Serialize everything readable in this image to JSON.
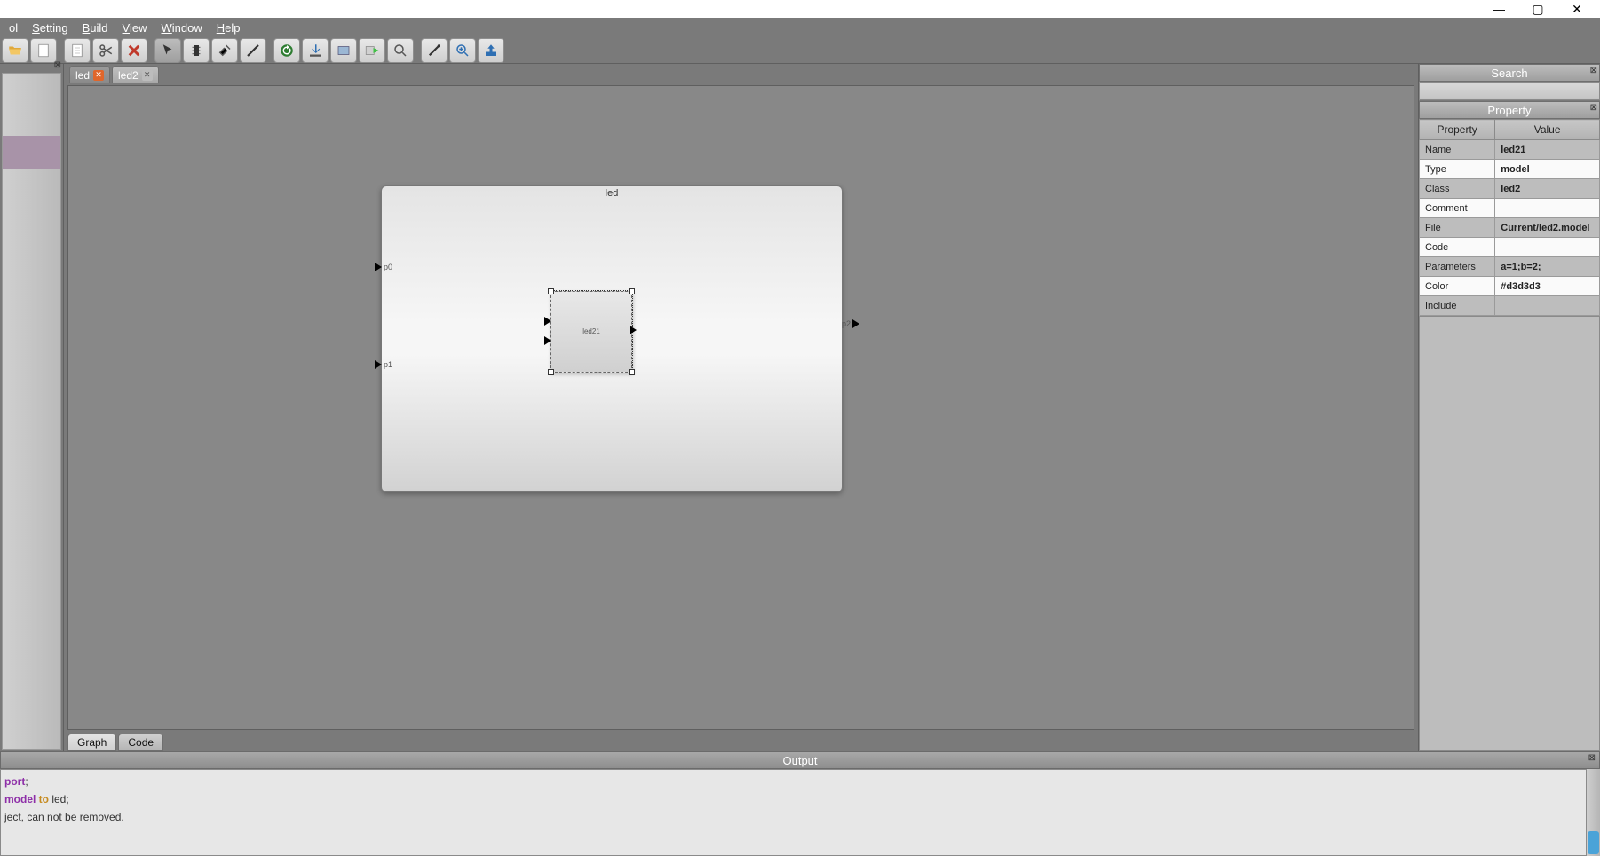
{
  "titlebar": {
    "min": "—",
    "max": "▢",
    "close": "✕"
  },
  "menu": {
    "items": [
      "ol",
      "Setting",
      "Build",
      "View",
      "Window",
      "Help"
    ]
  },
  "toolbar": {
    "icons": [
      "open",
      "new",
      "doc",
      "cut",
      "delete",
      "pointer",
      "device",
      "clean",
      "erase",
      "pencil",
      "refresh",
      "download",
      "rect",
      "run",
      "find",
      "wand",
      "zoomplus",
      "export"
    ]
  },
  "tabs": [
    {
      "label": "led",
      "closeStyle": "orange",
      "active": true
    },
    {
      "label": "led2",
      "closeStyle": "gray",
      "active": false
    }
  ],
  "diagram": {
    "bigBlockTitle": "led",
    "smallBlockTitle": "led21",
    "ports": {
      "p0": "p0",
      "p1": "p1",
      "p2": "p2"
    }
  },
  "bottomTabs": [
    {
      "label": "Graph",
      "active": true
    },
    {
      "label": "Code",
      "active": false
    }
  ],
  "search": {
    "title": "Search"
  },
  "propertyPanel": {
    "title": "Property",
    "columns": {
      "prop": "Property",
      "val": "Value"
    },
    "rows": [
      {
        "k": "Name",
        "v": "led21",
        "gray": true
      },
      {
        "k": "Type",
        "v": "model",
        "gray": false
      },
      {
        "k": "Class",
        "v": "led2",
        "gray": true
      },
      {
        "k": "Comment",
        "v": "",
        "gray": false
      },
      {
        "k": "File",
        "v": "Current/led2.model",
        "gray": true
      },
      {
        "k": "Code",
        "v": "",
        "gray": false
      },
      {
        "k": "Parameters",
        "v": "a=1;b=2;",
        "gray": true
      },
      {
        "k": "Color",
        "v": "#d3d3d3",
        "gray": false
      },
      {
        "k": "Include",
        "v": "",
        "gray": true
      }
    ]
  },
  "output": {
    "title": "Output",
    "line1a": "port",
    "line1b": ";",
    "line2a": "model",
    "line2b": " to ",
    "line2c": "led;",
    "line3": "ject, can not be removed."
  }
}
